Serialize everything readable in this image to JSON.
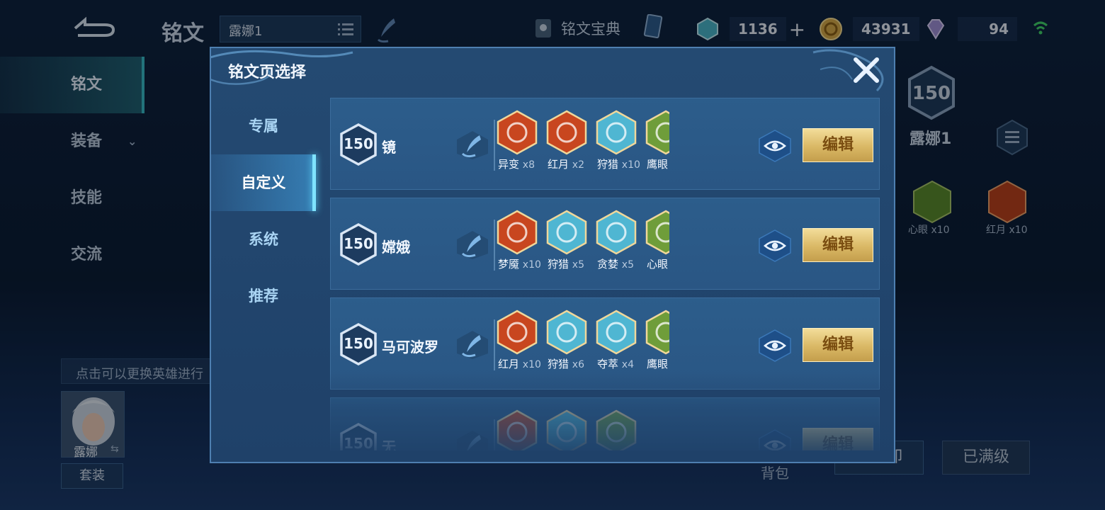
{
  "background": {
    "title": "铭文",
    "page_select": "露娜1",
    "codex_label": "铭文宝典",
    "currencies": [
      {
        "name": "shard-currency",
        "value": "1136",
        "color": "#49b3c9"
      },
      {
        "name": "gold-coins",
        "value": "43931",
        "color": "#d3a84a"
      },
      {
        "name": "diamonds",
        "value": "94",
        "color": "#9d8fd6"
      }
    ],
    "nav": [
      {
        "label": "铭文"
      },
      {
        "label": "装备"
      },
      {
        "label": "技能"
      },
      {
        "label": "交流"
      }
    ],
    "hint": "点击可以更换英雄进行",
    "hero_name": "露娜",
    "outfit_button": "套装",
    "right_panel": {
      "level": "150",
      "page_name": "露娜1",
      "runes": [
        {
          "name": "心眼",
          "count": "x10",
          "color": "#6f9d3a"
        },
        {
          "name": "红月",
          "count": "x10",
          "color": "#c8461f"
        }
      ]
    },
    "bag_label": "背包",
    "unload_button": "一键卸",
    "maxed_button": "已满级"
  },
  "modal": {
    "title": "铭文页选择",
    "tabs": [
      {
        "label": "专属"
      },
      {
        "label": "自定义"
      },
      {
        "label": "系统"
      },
      {
        "label": "推荐"
      }
    ],
    "active_tab": "自定义",
    "edit_label": "编辑",
    "pages": [
      {
        "level": "150",
        "name": "镜",
        "runes": [
          {
            "name": "异变",
            "count": "x8",
            "color": "#c8461f"
          },
          {
            "name": "红月",
            "count": "x2",
            "color": "#c8461f"
          },
          {
            "name": "狩猎",
            "count": "x10",
            "color": "#4fb6d2"
          },
          {
            "name": "鹰眼",
            "count": "",
            "color": "#6f9d3a"
          }
        ]
      },
      {
        "level": "150",
        "name": "嫦娥",
        "runes": [
          {
            "name": "梦魇",
            "count": "x10",
            "color": "#c8461f"
          },
          {
            "name": "狩猎",
            "count": "x5",
            "color": "#4fb6d2"
          },
          {
            "name": "贪婪",
            "count": "x5",
            "color": "#4fb6d2"
          },
          {
            "name": "心眼",
            "count": "",
            "color": "#6f9d3a"
          }
        ]
      },
      {
        "level": "150",
        "name": "马可波罗",
        "runes": [
          {
            "name": "红月",
            "count": "x10",
            "color": "#c8461f"
          },
          {
            "name": "狩猎",
            "count": "x6",
            "color": "#4fb6d2"
          },
          {
            "name": "夺萃",
            "count": "x4",
            "color": "#4fb6d2"
          },
          {
            "name": "鹰眼",
            "count": "",
            "color": "#6f9d3a"
          }
        ]
      },
      {
        "level": "150",
        "name": "无",
        "runes": [
          {
            "name": "",
            "count": "",
            "color": "#c8461f"
          },
          {
            "name": "",
            "count": "",
            "color": "#4fb6d2"
          },
          {
            "name": "",
            "count": "",
            "color": "#6f9d3a"
          }
        ]
      }
    ]
  }
}
